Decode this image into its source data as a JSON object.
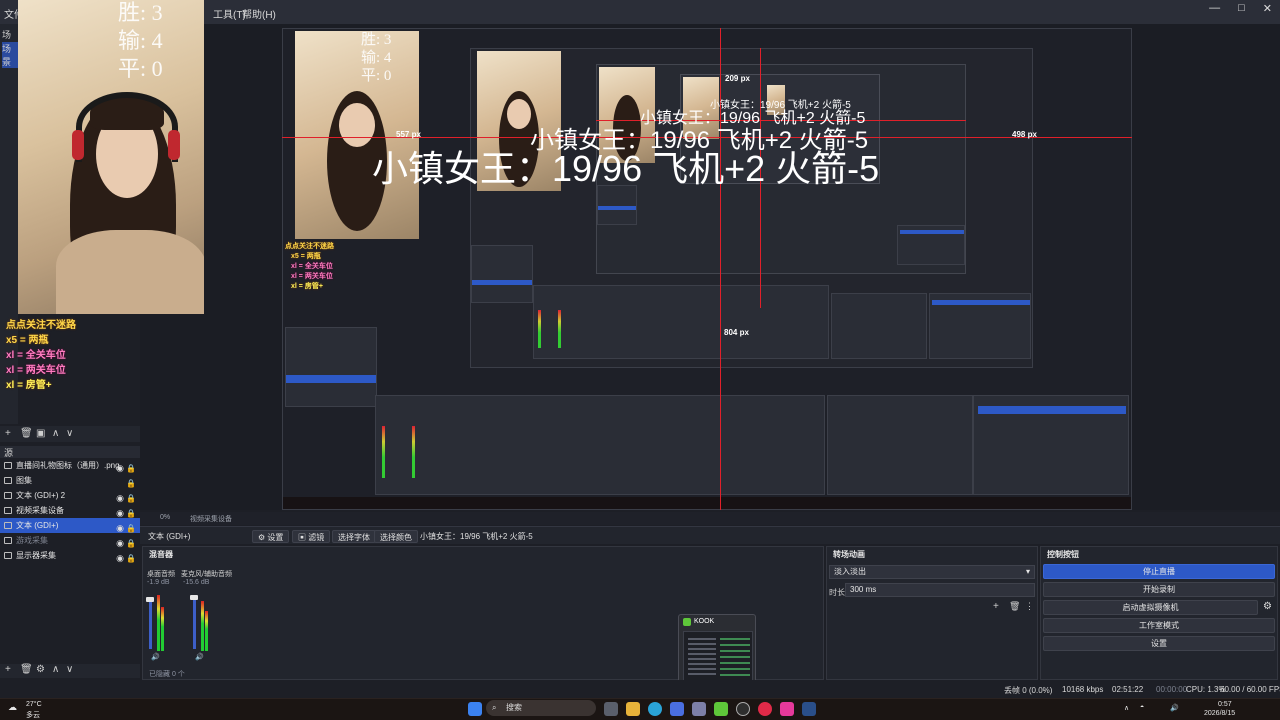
{
  "menu": {
    "file": "文件",
    "tools": "工具(T)",
    "help": "帮助(H)"
  },
  "window_controls": {
    "minimize": "—",
    "maximize": "□",
    "close": "✕"
  },
  "scene_dock": {
    "header": "场景",
    "selected": "场景"
  },
  "score": {
    "win": "胜: 3",
    "lose": "输: 4",
    "draw": "平: 0"
  },
  "gifts": [
    "点点关注不迷路",
    "x5 = 两瓶",
    "xl = 全关车位",
    "xl = 两关车位",
    "xl = 房管+"
  ],
  "source_toolbar": {
    "add": "+",
    "remove": "🗑",
    "filter": "▣",
    "up": "∧",
    "down": "∨"
  },
  "sources_header": "源",
  "sources": [
    {
      "name": "直播间礼物图标（通用）.png",
      "visible": true
    },
    {
      "name": "图集",
      "visible": false
    },
    {
      "name": "文本 (GDI+) 2",
      "visible": true
    },
    {
      "name": "视频采集设备",
      "visible": true
    },
    {
      "name": "文本 (GDI+)",
      "visible": true,
      "selected": true
    },
    {
      "name": "游戏采集",
      "visible": true,
      "dim": true
    },
    {
      "name": "显示器采集",
      "visible": true
    }
  ],
  "preview": {
    "overlay_text": "小镇女王：19/96 飞机+2 火箭-5",
    "px_labels": [
      "209 px",
      "498 px",
      "804 px",
      "557 px"
    ],
    "mini_score": {
      "win": "胜: 3",
      "lose": "输: 4",
      "draw": "平: 0"
    }
  },
  "sub_bar": {
    "left": "0%",
    "mid": "视频采集设备"
  },
  "props_bar": {
    "source_name": "文本 (GDI+)",
    "settings": "设置",
    "filters": "滤镜",
    "select_font": "选择字体",
    "select_color": "选择颜色",
    "text_value": "小镇女王：19/96 飞机+2 火箭-5"
  },
  "mixer": {
    "title": "混音器",
    "channels": [
      {
        "name": "桌面音频",
        "db": "-1.9 dB"
      },
      {
        "name": "麦克风/辅助音频",
        "db": "-15.6 dB"
      }
    ],
    "footer": "已隐藏 0 个"
  },
  "transitions": {
    "title": "转场动画",
    "type": "淡入淡出",
    "duration_label": "时长",
    "duration_value": "300 ms"
  },
  "controls": {
    "title": "控制按钮",
    "stop_stream": "停止直播",
    "start_record": "开始录制",
    "virtual_cam": "启动虚拟摄像机",
    "studio_mode": "工作室模式",
    "settings": "设置"
  },
  "kook_popup": {
    "title": "KOOK"
  },
  "status": {
    "dropped": "丢帧 0 (0.0%)",
    "bitrate": "10168 kbps",
    "live_time": "02:51:22",
    "rec_time": "00:00:00",
    "cpu": "CPU: 1.3%",
    "fps": "60.00 / 60.00 FPS"
  },
  "taskbar": {
    "weather_temp": "27°C",
    "weather_desc": "多云",
    "search": "搜索",
    "time": "0:57",
    "date": "2026/8/15"
  },
  "colors": {
    "accent": "#2d59c7",
    "red_guide": "#e0202a",
    "gift_yellow": "#ffd84a",
    "gift_pink": "#ff7cc0"
  }
}
